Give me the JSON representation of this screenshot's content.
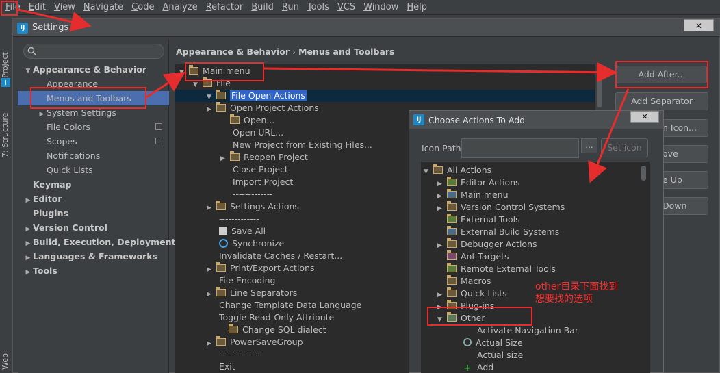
{
  "menubar": {
    "items": [
      "File",
      "Edit",
      "View",
      "Navigate",
      "Code",
      "Analyze",
      "Refactor",
      "Build",
      "Run",
      "Tools",
      "VCS",
      "Window",
      "Help"
    ]
  },
  "toolstrip": {
    "project_tab": "1: Project",
    "structure_tab": "7: Structure",
    "web_tab": "Web"
  },
  "settings": {
    "title": "Settings",
    "close_label": "✕",
    "nav": [
      {
        "label": "Appearance & Behavior",
        "bold": true,
        "expanded": true
      },
      {
        "label": "Appearance",
        "bold": false
      },
      {
        "label": "Menus and Toolbars",
        "bold": false,
        "selected": true
      },
      {
        "label": "System Settings",
        "bold": false,
        "collapsed": true
      },
      {
        "label": "File Colors",
        "bold": false,
        "copy": true
      },
      {
        "label": "Scopes",
        "bold": false,
        "copy": true
      },
      {
        "label": "Notifications",
        "bold": false
      },
      {
        "label": "Quick Lists",
        "bold": false
      },
      {
        "label": "Keymap",
        "bold": true
      },
      {
        "label": "Editor",
        "bold": true,
        "collapsed": true
      },
      {
        "label": "Plugins",
        "bold": true
      },
      {
        "label": "Version Control",
        "bold": true,
        "collapsed": true
      },
      {
        "label": "Build, Execution, Deployment",
        "bold": true,
        "collapsed": true
      },
      {
        "label": "Languages & Frameworks",
        "bold": true,
        "collapsed": true
      },
      {
        "label": "Tools",
        "bold": true,
        "collapsed": true
      }
    ],
    "breadcrumb": {
      "parent": "Appearance & Behavior",
      "sep": "›",
      "current": "Menus and Toolbars"
    },
    "tree": [
      {
        "label": "Main menu",
        "type": "folder",
        "toggle": "expanded"
      },
      {
        "label": "File",
        "type": "folder",
        "toggle": "expanded"
      },
      {
        "label": "File Open Actions",
        "type": "folder",
        "toggle": "expanded",
        "selected": true
      },
      {
        "label": "Open Project Actions",
        "type": "folder",
        "toggle": "collapsed"
      },
      {
        "label": "Open...",
        "type": "folder",
        "toggle": "none"
      },
      {
        "label": "Open URL...",
        "type": "item"
      },
      {
        "label": "New Project from Existing Files...",
        "type": "item"
      },
      {
        "label": "Reopen Project",
        "type": "folder",
        "toggle": "collapsed"
      },
      {
        "label": "Close Project",
        "type": "item"
      },
      {
        "label": "Import Project",
        "type": "item"
      },
      {
        "label": "-------------",
        "type": "item"
      },
      {
        "label": "Settings Actions",
        "type": "folder",
        "toggle": "collapsed"
      },
      {
        "label": "-------------",
        "type": "item"
      },
      {
        "label": "Save All",
        "type": "save"
      },
      {
        "label": "Synchronize",
        "type": "sync"
      },
      {
        "label": "Invalidate Caches / Restart...",
        "type": "item"
      },
      {
        "label": "Print/Export Actions",
        "type": "folder",
        "toggle": "collapsed"
      },
      {
        "label": "File Encoding",
        "type": "item"
      },
      {
        "label": "Line Separators",
        "type": "folder",
        "toggle": "collapsed"
      },
      {
        "label": "Change Template Data Language",
        "type": "item"
      },
      {
        "label": "Toggle Read-Only Attribute",
        "type": "item"
      },
      {
        "label": "Change SQL dialect",
        "type": "folder",
        "toggle": "none"
      },
      {
        "label": "PowerSaveGroup",
        "type": "folder",
        "toggle": "collapsed"
      },
      {
        "label": "-------------",
        "type": "item"
      },
      {
        "label": "Exit",
        "type": "item"
      }
    ],
    "buttons": {
      "add_after": "Add After...",
      "add_separator": "Add Separator",
      "edit_icon": "n Icon...",
      "remove": "ove",
      "move_up": "e Up",
      "move_down": "Down"
    }
  },
  "choose_dialog": {
    "title": "Choose Actions To Add",
    "close_label": "✕",
    "icon_path_label": "Icon Path:",
    "icon_path_value": "",
    "browse_label": "...",
    "set_icon_label": "Set icon",
    "tree": [
      {
        "label": "All Actions",
        "toggle": "expanded",
        "icon": "folder"
      },
      {
        "label": "Editor Actions",
        "toggle": "collapsed",
        "icon": "folder-edit"
      },
      {
        "label": "Main menu",
        "toggle": "collapsed",
        "icon": "folder-menu"
      },
      {
        "label": "Version Control Systems",
        "toggle": "collapsed",
        "icon": "folder"
      },
      {
        "label": "External Tools",
        "toggle": "none",
        "icon": "folder-edit"
      },
      {
        "label": "External Build Systems",
        "toggle": "none",
        "icon": "folder-gear"
      },
      {
        "label": "Debugger Actions",
        "toggle": "collapsed",
        "icon": "folder"
      },
      {
        "label": "Ant Targets",
        "toggle": "none",
        "icon": "folder-ant"
      },
      {
        "label": "Remote External Tools",
        "toggle": "none",
        "icon": "folder-edit"
      },
      {
        "label": "Macros",
        "toggle": "none",
        "icon": "folder"
      },
      {
        "label": "Quick Lists",
        "toggle": "collapsed",
        "icon": "folder"
      },
      {
        "label": "Plug-ins",
        "toggle": "collapsed",
        "icon": "folder"
      },
      {
        "label": "Other",
        "toggle": "expanded",
        "icon": "folder-other"
      },
      {
        "label": "Activate Navigation Bar",
        "toggle": "none",
        "icon": "none",
        "child": true
      },
      {
        "label": "Actual Size",
        "toggle": "none",
        "icon": "zoom",
        "child": true
      },
      {
        "label": "Actual size",
        "toggle": "none",
        "icon": "none",
        "child": true
      },
      {
        "label": "Add",
        "toggle": "none",
        "icon": "plus",
        "child": true
      }
    ]
  },
  "annotation": {
    "note_line1": "other目录下面找到",
    "note_line2": "想要找的选项",
    "color": "#e52d2d"
  }
}
